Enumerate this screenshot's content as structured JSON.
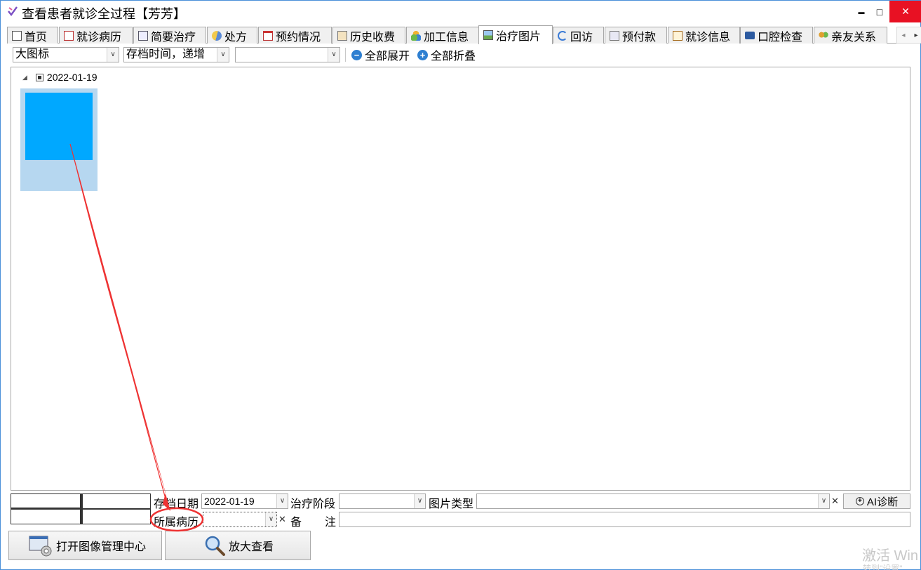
{
  "window": {
    "title": "查看患者就诊全过程【芳芳】",
    "minimize_glyph": "▬",
    "maximize_glyph": "□",
    "close_glyph": "✕"
  },
  "tabs": [
    {
      "label": "首页",
      "icon": "home-icon",
      "active": false
    },
    {
      "label": "就诊病历",
      "icon": "medical-record-icon",
      "active": false
    },
    {
      "label": "简要治疗",
      "icon": "document-icon",
      "active": false
    },
    {
      "label": "处方",
      "icon": "pill-icon",
      "active": false
    },
    {
      "label": "预约情况",
      "icon": "calendar-icon",
      "active": false
    },
    {
      "label": "历史收费",
      "icon": "billing-icon",
      "active": false
    },
    {
      "label": "加工信息",
      "icon": "processing-icon",
      "active": false
    },
    {
      "label": "治疗图片",
      "icon": "picture-icon",
      "active": true
    },
    {
      "label": "回访",
      "icon": "refresh-icon",
      "active": false
    },
    {
      "label": "预付款",
      "icon": "prepayment-icon",
      "active": false
    },
    {
      "label": "就诊信息",
      "icon": "clipboard-icon",
      "active": false
    },
    {
      "label": "口腔检查",
      "icon": "toolbox-icon",
      "active": false
    },
    {
      "label": "亲友关系",
      "icon": "people-icon",
      "active": false
    }
  ],
  "toolbar": {
    "view_mode": "大图标",
    "sort_order": "存档时间，递增",
    "filter": "",
    "expand_all": "全部展开",
    "collapse_all": "全部折叠"
  },
  "gallery": {
    "group_date": "2022-01-19",
    "images": [
      {
        "color": "#00a8ff"
      }
    ]
  },
  "form": {
    "archive_date_label": "存档日期",
    "archive_date_value": "2022-01-19",
    "treatment_stage_label": "治疗阶段",
    "treatment_stage_value": "",
    "image_type_label": "图片类型",
    "image_type_value": "",
    "ai_button": "AI诊断",
    "record_label": "所属病历",
    "record_value": "",
    "remark_label": "备",
    "remark_label2": "注",
    "remark_value": ""
  },
  "buttons": {
    "open_image_center": "打开图像管理中心",
    "zoom_view": "放大查看"
  },
  "watermark": {
    "line1": "激活 Win",
    "line2": "转到\"设置\""
  },
  "colors": {
    "accent": "#2e7fd1",
    "close": "#e81123",
    "annotation": "#ee3333",
    "thumb_bg": "#b6d7f0"
  }
}
